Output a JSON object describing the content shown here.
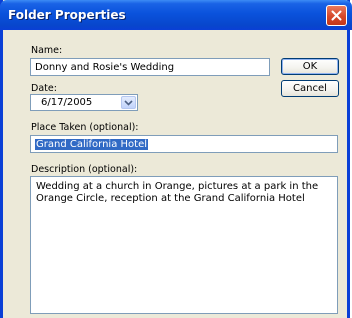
{
  "window": {
    "title": "Folder Properties"
  },
  "name": {
    "label": "Name:",
    "value": "Donny and Rosie's Wedding"
  },
  "buttons": {
    "ok_label": "OK",
    "cancel_label": "Cancel"
  },
  "date": {
    "label": "Date:",
    "value": "6/17/2005"
  },
  "place": {
    "label": "Place Taken (optional):",
    "value": "Grand California Hotel"
  },
  "description": {
    "label": "Description (optional):",
    "value": "Wedding at a church in Orange, pictures at a park in the Orange Circle, reception at the Grand California Hotel"
  },
  "colors": {
    "title_bar": "#0a52dc",
    "dialog_background": "#ece9d8",
    "selection": "#316ac5",
    "close_button": "#d6482a"
  }
}
